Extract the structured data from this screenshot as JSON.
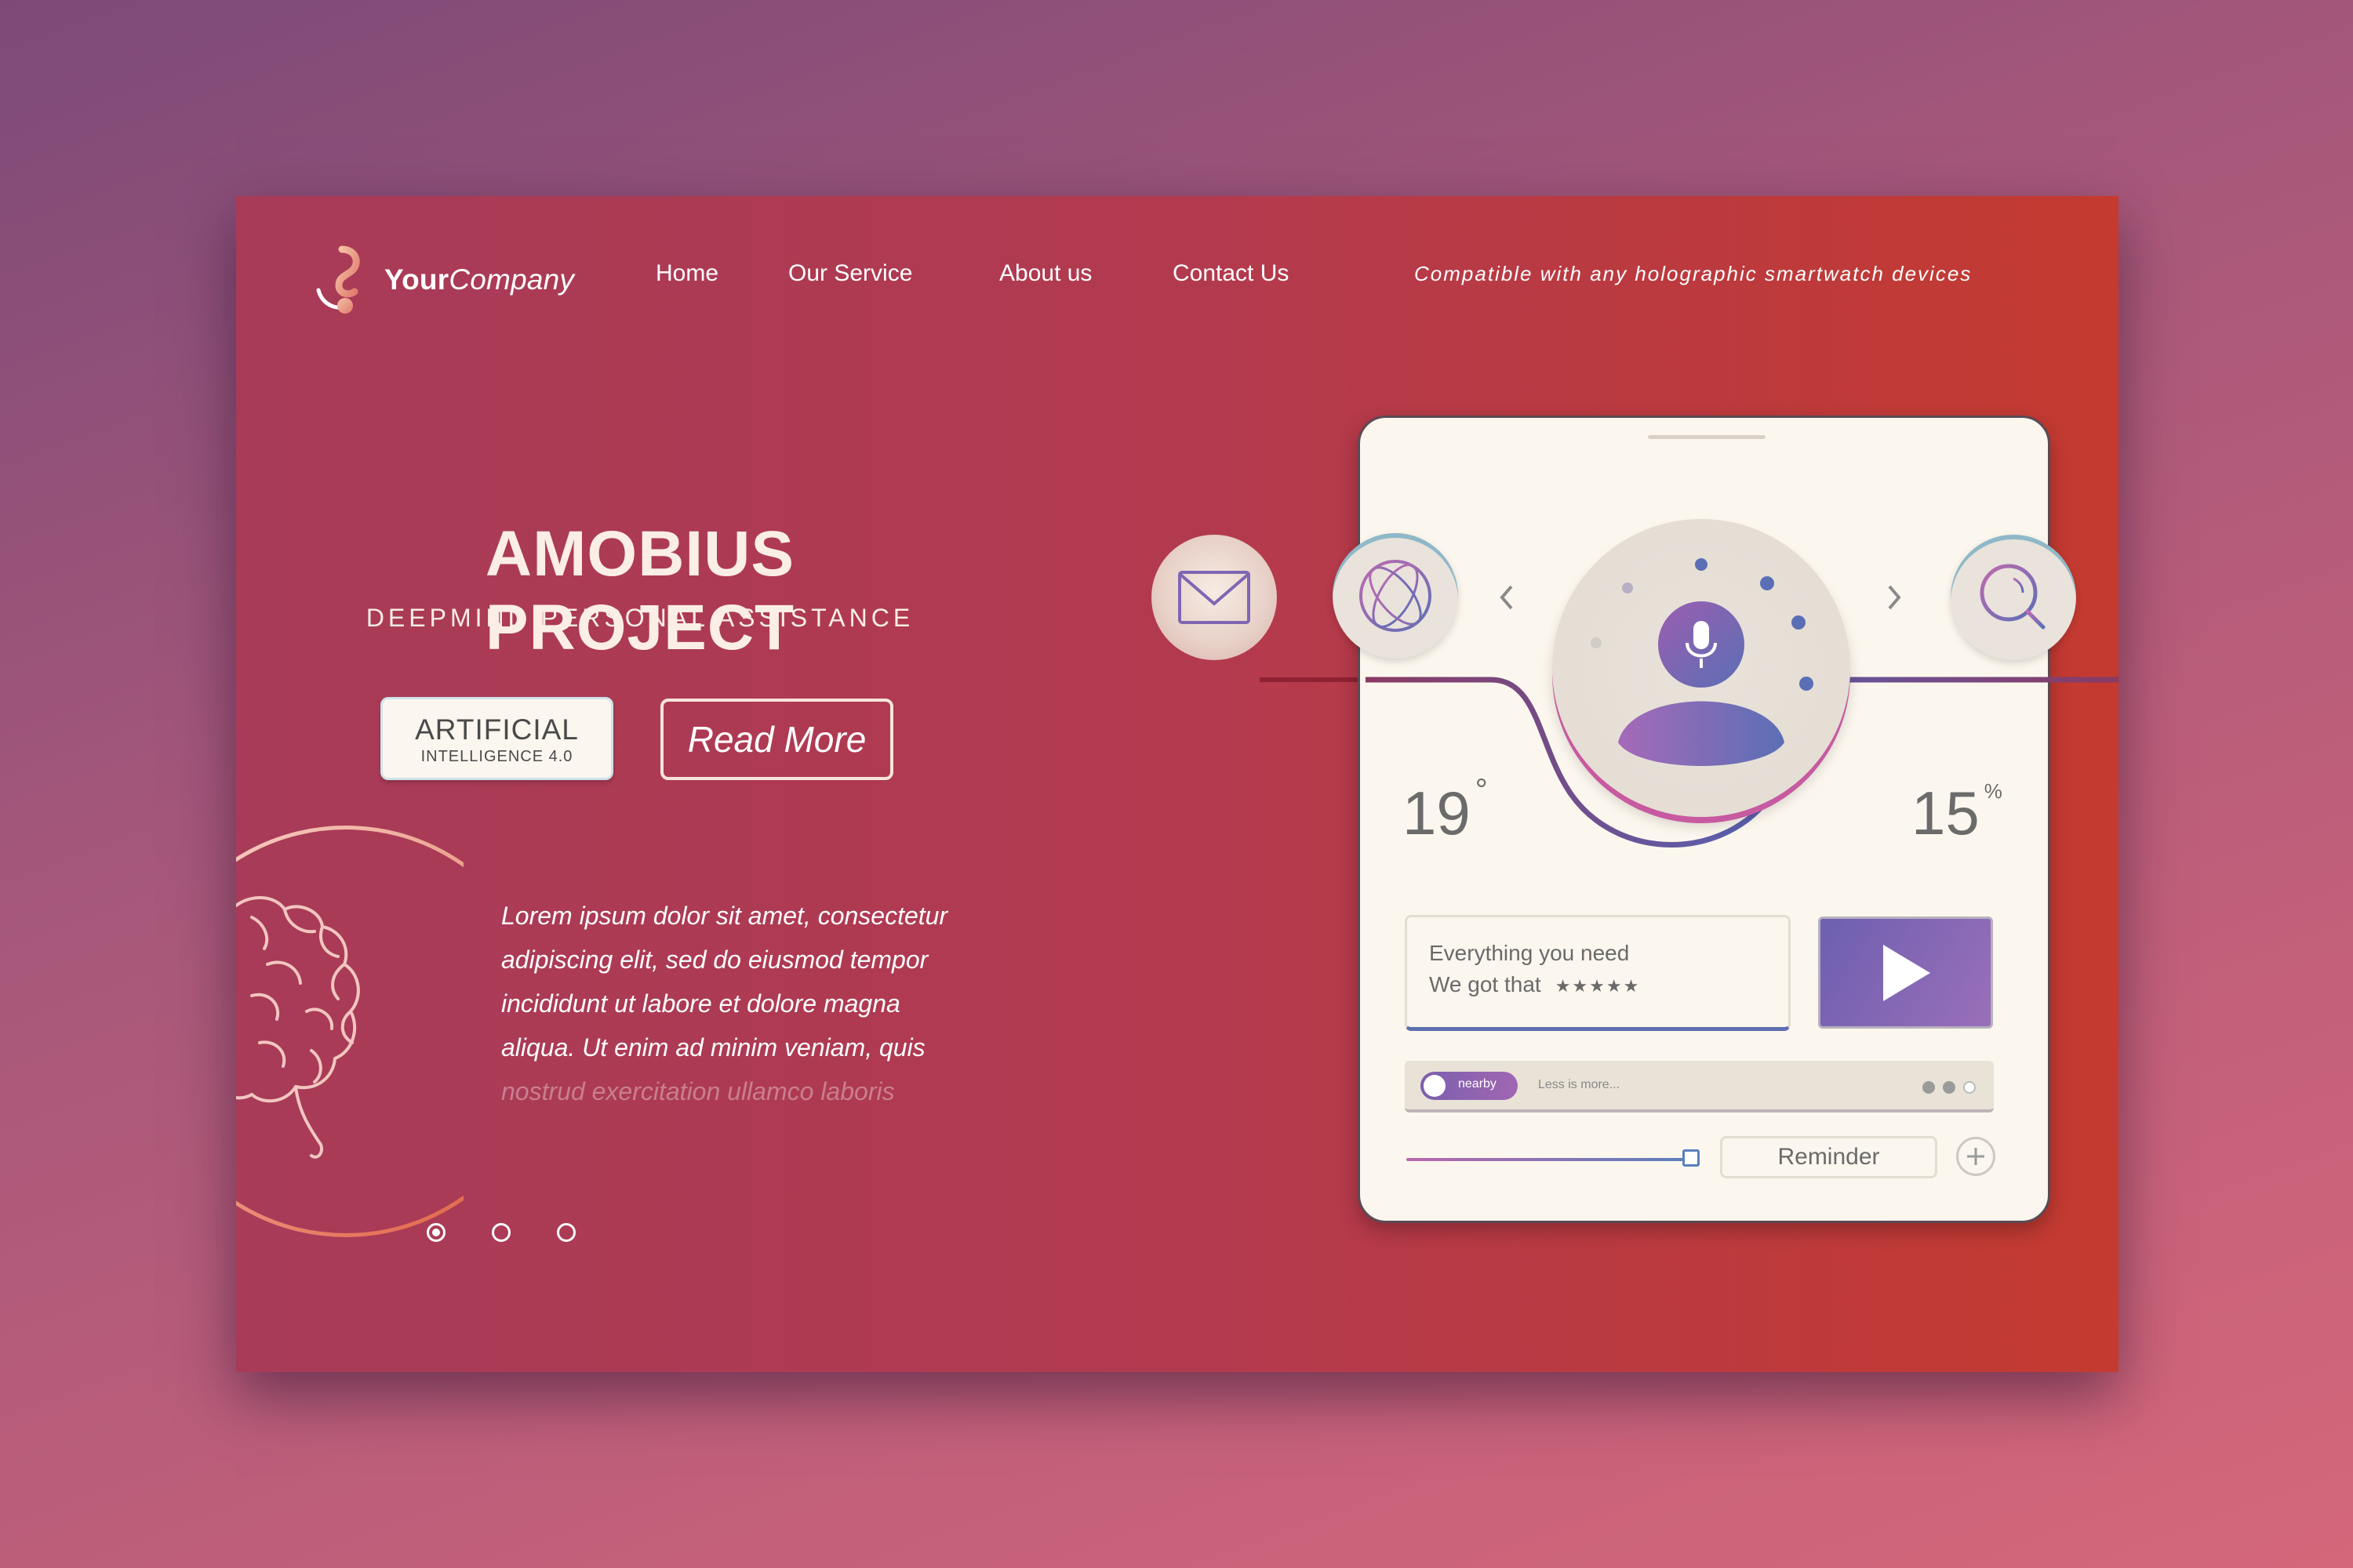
{
  "brand": {
    "name_bold": "Your",
    "name_italic": "Company"
  },
  "nav": [
    {
      "label": "Home"
    },
    {
      "label": "Our Service"
    },
    {
      "label": "About us"
    },
    {
      "label": "Contact Us"
    }
  ],
  "tagline": "Compatible with any holographic smartwatch devices",
  "hero": {
    "title": "AMOBIUS PROJECT",
    "subtitle": "DEEPMIND PERSONAL ASSISTANCE",
    "badge_line1": "ARTIFICIAL",
    "badge_line2": "INTELLIGENCE 4.0",
    "cta": "Read More",
    "body_lines": [
      "Lorem ipsum dolor sit amet, consectetur",
      "adipiscing elit, sed do eiusmod tempor",
      "incididunt ut labore et dolore magna",
      "aliqua. Ut enim ad minim veniam, quis",
      "nostrud exercitation ullamco laboris"
    ]
  },
  "pagination": {
    "count": 3,
    "active": 1
  },
  "device": {
    "temperature": "19",
    "temperature_unit": "°",
    "humidity": "15",
    "humidity_unit": "%",
    "message_line1": "Everything you need",
    "message_line2": "We got that",
    "rating_stars": "★★★★★",
    "toggle_label": "nearby",
    "status_text": "Less is more...",
    "slider_value": 0.96,
    "reminder_label": "Reminder",
    "icons": [
      "mail-icon",
      "globe-icon",
      "microphone-icon",
      "user-icon",
      "search-icon",
      "chevron-left-icon",
      "chevron-right-icon",
      "play-icon",
      "plus-icon"
    ]
  },
  "colors": {
    "panel_start": "#a83b58",
    "panel_end": "#c43a30",
    "accent_purple": "#8a64b3",
    "accent_blue": "#5b6fb5",
    "card_bg": "#fcf7ee"
  }
}
